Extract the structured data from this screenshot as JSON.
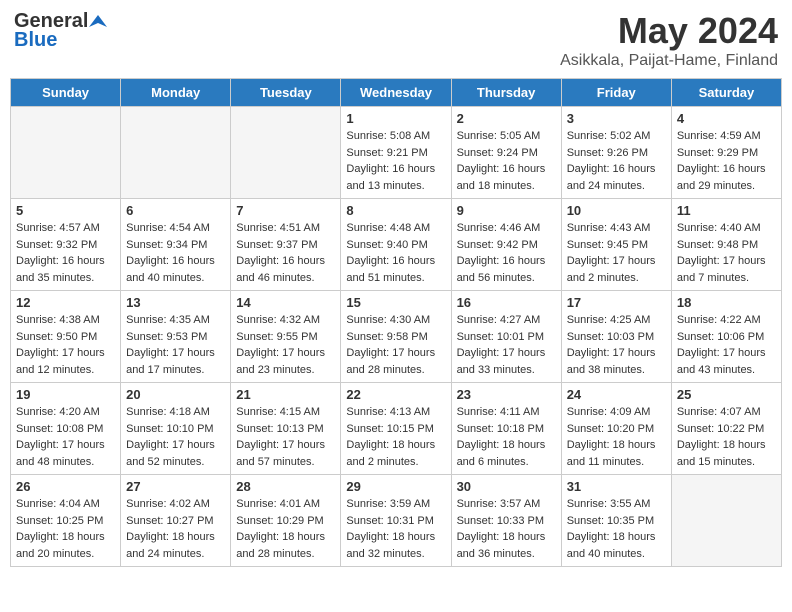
{
  "logo": {
    "general": "General",
    "blue": "Blue"
  },
  "title": "May 2024",
  "subtitle": "Asikkala, Paijat-Hame, Finland",
  "days_of_week": [
    "Sunday",
    "Monday",
    "Tuesday",
    "Wednesday",
    "Thursday",
    "Friday",
    "Saturday"
  ],
  "weeks": [
    [
      {
        "day": "",
        "empty": true
      },
      {
        "day": "",
        "empty": true
      },
      {
        "day": "",
        "empty": true
      },
      {
        "day": "1",
        "info": "Sunrise: 5:08 AM\nSunset: 9:21 PM\nDaylight: 16 hours\nand 13 minutes."
      },
      {
        "day": "2",
        "info": "Sunrise: 5:05 AM\nSunset: 9:24 PM\nDaylight: 16 hours\nand 18 minutes."
      },
      {
        "day": "3",
        "info": "Sunrise: 5:02 AM\nSunset: 9:26 PM\nDaylight: 16 hours\nand 24 minutes."
      },
      {
        "day": "4",
        "info": "Sunrise: 4:59 AM\nSunset: 9:29 PM\nDaylight: 16 hours\nand 29 minutes."
      }
    ],
    [
      {
        "day": "5",
        "info": "Sunrise: 4:57 AM\nSunset: 9:32 PM\nDaylight: 16 hours\nand 35 minutes."
      },
      {
        "day": "6",
        "info": "Sunrise: 4:54 AM\nSunset: 9:34 PM\nDaylight: 16 hours\nand 40 minutes."
      },
      {
        "day": "7",
        "info": "Sunrise: 4:51 AM\nSunset: 9:37 PM\nDaylight: 16 hours\nand 46 minutes."
      },
      {
        "day": "8",
        "info": "Sunrise: 4:48 AM\nSunset: 9:40 PM\nDaylight: 16 hours\nand 51 minutes."
      },
      {
        "day": "9",
        "info": "Sunrise: 4:46 AM\nSunset: 9:42 PM\nDaylight: 16 hours\nand 56 minutes."
      },
      {
        "day": "10",
        "info": "Sunrise: 4:43 AM\nSunset: 9:45 PM\nDaylight: 17 hours\nand 2 minutes."
      },
      {
        "day": "11",
        "info": "Sunrise: 4:40 AM\nSunset: 9:48 PM\nDaylight: 17 hours\nand 7 minutes."
      }
    ],
    [
      {
        "day": "12",
        "info": "Sunrise: 4:38 AM\nSunset: 9:50 PM\nDaylight: 17 hours\nand 12 minutes."
      },
      {
        "day": "13",
        "info": "Sunrise: 4:35 AM\nSunset: 9:53 PM\nDaylight: 17 hours\nand 17 minutes."
      },
      {
        "day": "14",
        "info": "Sunrise: 4:32 AM\nSunset: 9:55 PM\nDaylight: 17 hours\nand 23 minutes."
      },
      {
        "day": "15",
        "info": "Sunrise: 4:30 AM\nSunset: 9:58 PM\nDaylight: 17 hours\nand 28 minutes."
      },
      {
        "day": "16",
        "info": "Sunrise: 4:27 AM\nSunset: 10:01 PM\nDaylight: 17 hours\nand 33 minutes."
      },
      {
        "day": "17",
        "info": "Sunrise: 4:25 AM\nSunset: 10:03 PM\nDaylight: 17 hours\nand 38 minutes."
      },
      {
        "day": "18",
        "info": "Sunrise: 4:22 AM\nSunset: 10:06 PM\nDaylight: 17 hours\nand 43 minutes."
      }
    ],
    [
      {
        "day": "19",
        "info": "Sunrise: 4:20 AM\nSunset: 10:08 PM\nDaylight: 17 hours\nand 48 minutes."
      },
      {
        "day": "20",
        "info": "Sunrise: 4:18 AM\nSunset: 10:10 PM\nDaylight: 17 hours\nand 52 minutes."
      },
      {
        "day": "21",
        "info": "Sunrise: 4:15 AM\nSunset: 10:13 PM\nDaylight: 17 hours\nand 57 minutes."
      },
      {
        "day": "22",
        "info": "Sunrise: 4:13 AM\nSunset: 10:15 PM\nDaylight: 18 hours\nand 2 minutes."
      },
      {
        "day": "23",
        "info": "Sunrise: 4:11 AM\nSunset: 10:18 PM\nDaylight: 18 hours\nand 6 minutes."
      },
      {
        "day": "24",
        "info": "Sunrise: 4:09 AM\nSunset: 10:20 PM\nDaylight: 18 hours\nand 11 minutes."
      },
      {
        "day": "25",
        "info": "Sunrise: 4:07 AM\nSunset: 10:22 PM\nDaylight: 18 hours\nand 15 minutes."
      }
    ],
    [
      {
        "day": "26",
        "info": "Sunrise: 4:04 AM\nSunset: 10:25 PM\nDaylight: 18 hours\nand 20 minutes."
      },
      {
        "day": "27",
        "info": "Sunrise: 4:02 AM\nSunset: 10:27 PM\nDaylight: 18 hours\nand 24 minutes."
      },
      {
        "day": "28",
        "info": "Sunrise: 4:01 AM\nSunset: 10:29 PM\nDaylight: 18 hours\nand 28 minutes."
      },
      {
        "day": "29",
        "info": "Sunrise: 3:59 AM\nSunset: 10:31 PM\nDaylight: 18 hours\nand 32 minutes."
      },
      {
        "day": "30",
        "info": "Sunrise: 3:57 AM\nSunset: 10:33 PM\nDaylight: 18 hours\nand 36 minutes."
      },
      {
        "day": "31",
        "info": "Sunrise: 3:55 AM\nSunset: 10:35 PM\nDaylight: 18 hours\nand 40 minutes."
      },
      {
        "day": "",
        "empty": true
      }
    ]
  ]
}
